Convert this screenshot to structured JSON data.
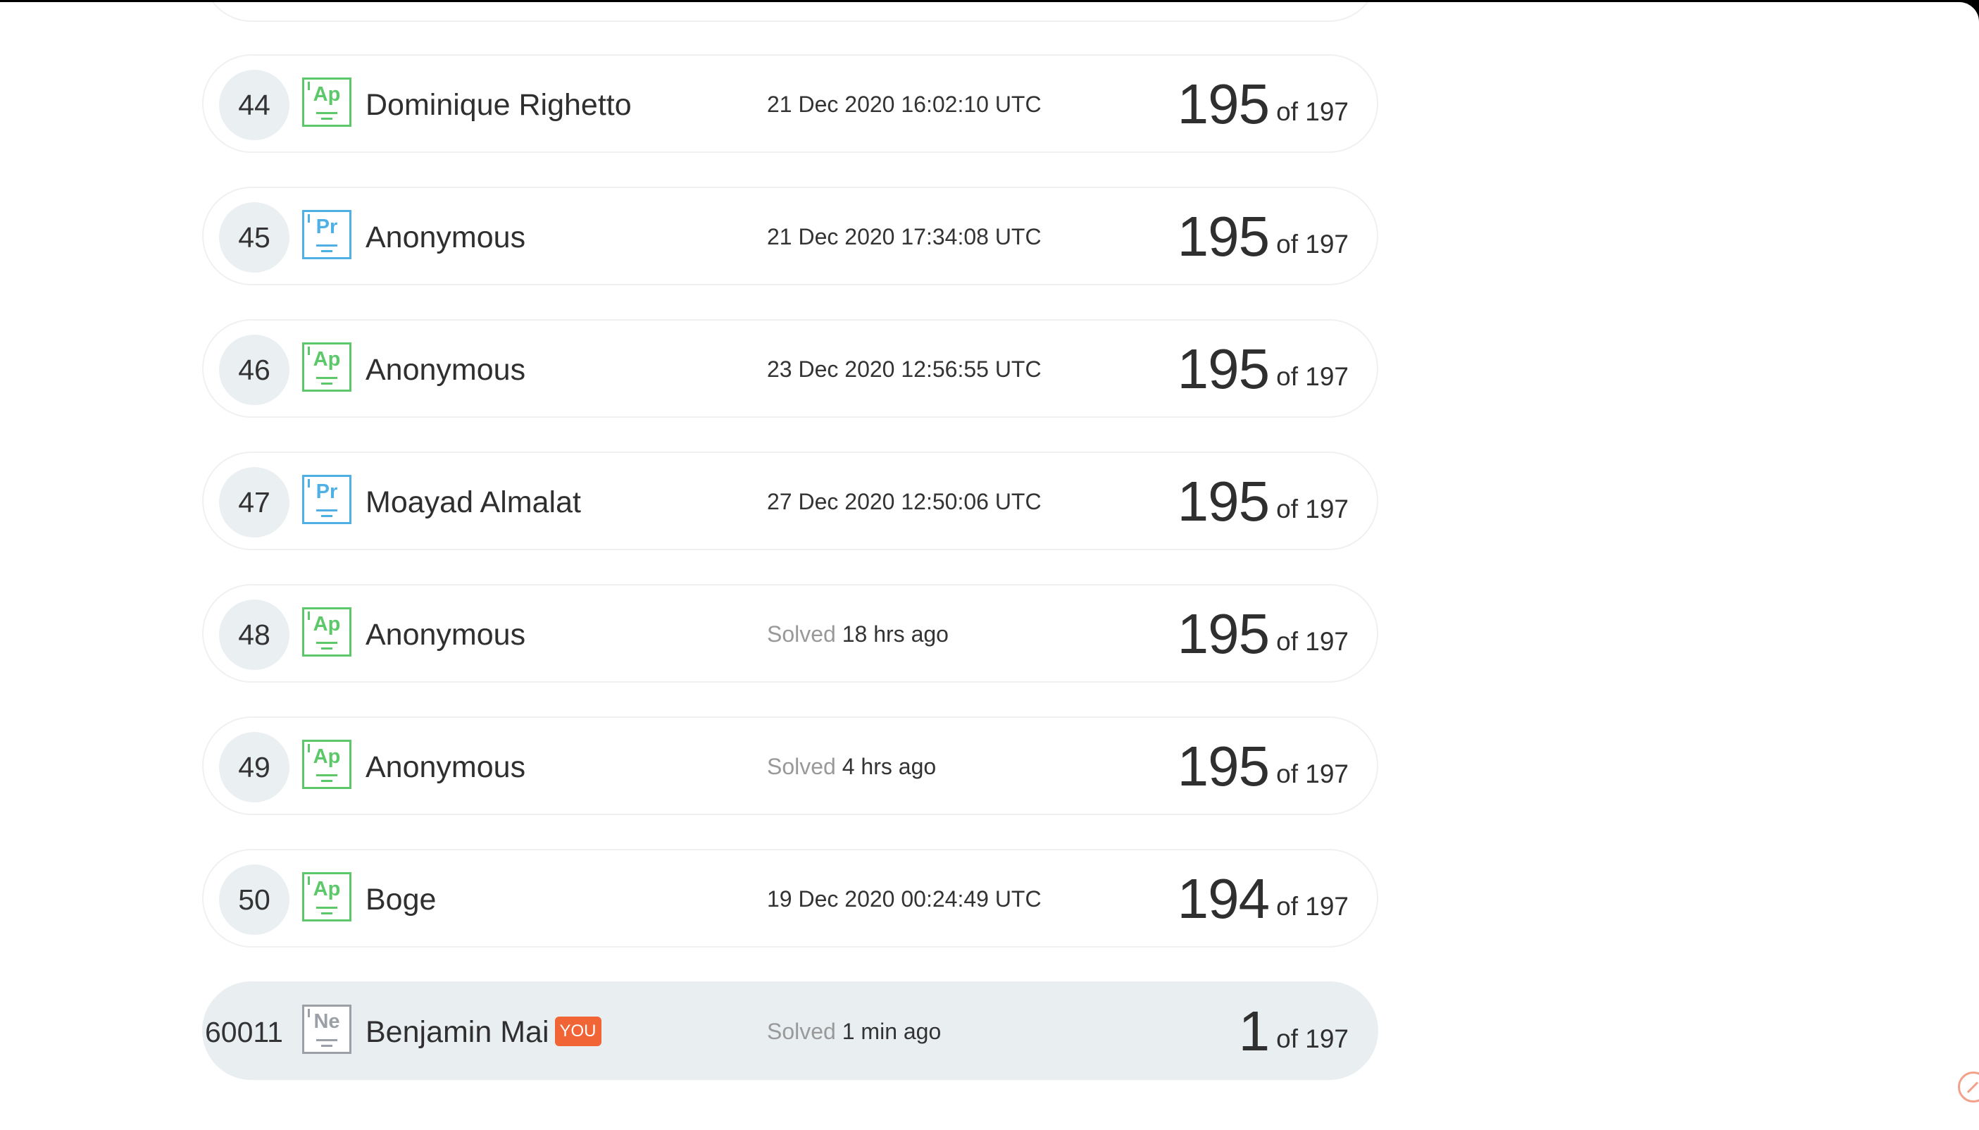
{
  "leaderboard": {
    "rows": [
      {
        "rank": "44",
        "element": "Ap",
        "element_color": "#5cc86a",
        "name": "Dominique Righetto",
        "time_prefix": "",
        "time": "21 Dec 2020 16:02:10 UTC",
        "solved": "195",
        "total": "of 197"
      },
      {
        "rank": "45",
        "element": "Pr",
        "element_color": "#4fb0e6",
        "name": "Anonymous",
        "time_prefix": "",
        "time": "21 Dec 2020 17:34:08 UTC",
        "solved": "195",
        "total": "of 197"
      },
      {
        "rank": "46",
        "element": "Ap",
        "element_color": "#5cc86a",
        "name": "Anonymous",
        "time_prefix": "",
        "time": "23 Dec 2020 12:56:55 UTC",
        "solved": "195",
        "total": "of 197"
      },
      {
        "rank": "47",
        "element": "Pr",
        "element_color": "#4fb0e6",
        "name": "Moayad Almalat",
        "time_prefix": "",
        "time": "27 Dec 2020 12:50:06 UTC",
        "solved": "195",
        "total": "of 197"
      },
      {
        "rank": "48",
        "element": "Ap",
        "element_color": "#5cc86a",
        "name": "Anonymous",
        "time_prefix": "Solved",
        "time": "18 hrs ago",
        "solved": "195",
        "total": "of 197"
      },
      {
        "rank": "49",
        "element": "Ap",
        "element_color": "#5cc86a",
        "name": "Anonymous",
        "time_prefix": "Solved",
        "time": "4 hrs ago",
        "solved": "195",
        "total": "of 197"
      },
      {
        "rank": "50",
        "element": "Ap",
        "element_color": "#5cc86a",
        "name": "Boge",
        "time_prefix": "",
        "time": "19 Dec 2020 00:24:49 UTC",
        "solved": "194",
        "total": "of 197"
      }
    ],
    "current_user": {
      "rank": "60011",
      "element": "Ne",
      "element_color": "#9aa0a6",
      "name": "Benjamin Mai",
      "you_label": "YOU",
      "time_prefix": "Solved",
      "time": "1 min ago",
      "solved": "1",
      "total": "of 197"
    }
  },
  "scroll_icon": "scroll-to-top-icon"
}
